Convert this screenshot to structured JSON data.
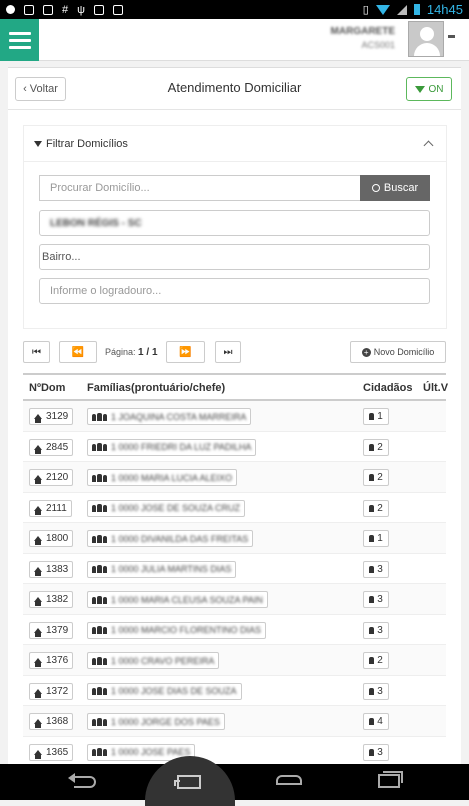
{
  "status_bar": {
    "time": "14h45"
  },
  "topbar": {
    "user_name": "MARGARETE",
    "user_role": "ACS001"
  },
  "page": {
    "back_label": "‹ Voltar",
    "title": "Atendimento Domiciliar",
    "connection_label": "ON"
  },
  "filter": {
    "title": "Filtrar Domicílios",
    "search_placeholder": "Procurar Domicílio...",
    "search_button": "Buscar",
    "unit_value": "LEBON RÉGIS - SC",
    "bairro_value": "Bairro...",
    "logradouro_placeholder": "Informe o logradouro..."
  },
  "pager": {
    "label": "Página:",
    "value": "1 / 1",
    "new_button": "Novo Domicílio"
  },
  "table": {
    "columns": [
      "NºDom",
      "Famílias(prontuário/chefe)",
      "Cidadãos",
      "Últ.V"
    ],
    "rows": [
      {
        "dom": "3129",
        "family": "1 JOAQUINA COSTA MARREIRA",
        "citizens": "1"
      },
      {
        "dom": "2845",
        "family": "1 0000 FRIEDRI DA LUZ PADILHA",
        "citizens": "2"
      },
      {
        "dom": "2120",
        "family": "1 0000 MARIA LUCIA ALEIXO",
        "citizens": "2"
      },
      {
        "dom": "2111",
        "family": "1 0000 JOSE DE SOUZA CRUZ",
        "citizens": "2"
      },
      {
        "dom": "1800",
        "family": "1 0000 DIVANILDA DAS FREITAS",
        "citizens": "1"
      },
      {
        "dom": "1383",
        "family": "1 0000 JULIA MARTINS DIAS",
        "citizens": "3"
      },
      {
        "dom": "1382",
        "family": "1 0000 MARIA CLEUSA SOUZA PAIN",
        "citizens": "3"
      },
      {
        "dom": "1379",
        "family": "1 0000 MARCIO FLORENTINO DIAS",
        "citizens": "3"
      },
      {
        "dom": "1376",
        "family": "1 0000 CRAVO PEREIRA",
        "citizens": "2"
      },
      {
        "dom": "1372",
        "family": "1 0000 JOSE DIAS DE SOUZA",
        "citizens": "3"
      },
      {
        "dom": "1368",
        "family": "1 0000 JORGE DOS PAES",
        "citizens": "4"
      },
      {
        "dom": "1365",
        "family": "1 0000 JOSE PAES",
        "citizens": "3"
      }
    ]
  },
  "colors": {
    "accent": "#22a885",
    "on_green": "#5cb85c",
    "search_btn": "#666666"
  }
}
